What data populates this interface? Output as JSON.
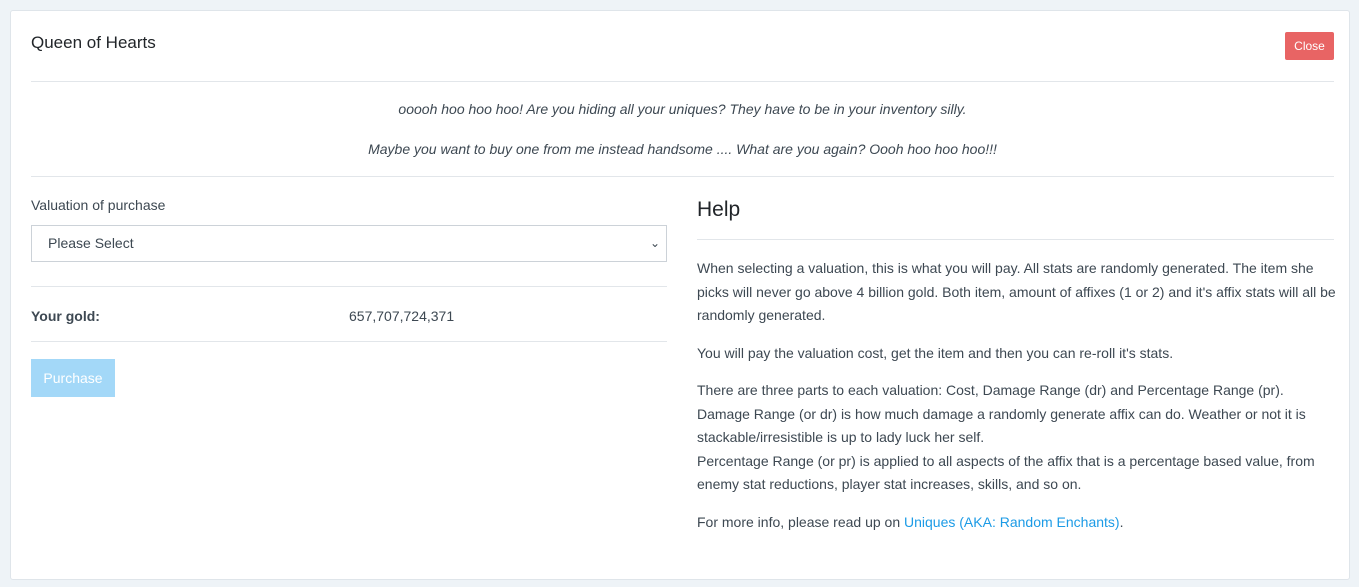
{
  "modal": {
    "title": "Queen of Hearts",
    "close_label": "Close"
  },
  "quotes": [
    "ooooh hoo hoo hoo! Are you hiding all your uniques? They have to be in your inventory silly.",
    "Maybe you want to buy one from me instead handsome .... What are you again? Oooh hoo hoo hoo!!!"
  ],
  "form": {
    "valuation_label": "Valuation of purchase",
    "valuation_selected": "Please Select",
    "gold_label": "Your gold:",
    "gold_value": "657,707,724,371",
    "purchase_label": "Purchase"
  },
  "help": {
    "title": "Help",
    "p1": "When selecting a valuation, this is what you will pay. All stats are randomly generated. The item she picks will never go above 4 billion gold. Both item, amount of affixes (1 or 2) and it's affix stats will all be randomly generated.",
    "p2": "You will pay the valuation cost, get the item and then you can re-roll it's stats.",
    "p3a": "There are three parts to each valuation: Cost, Damage Range (dr) and Percentage Range (pr).",
    "p3b": "Damage Range (or dr) is how much damage a randomly generate affix can do. Weather or not it is stackable/irresistible is up to lady luck her self.",
    "p3c": "Percentage Range (or pr) is applied to all aspects of the affix that is a percentage based value, from enemy stat reductions, player stat increases, skills, and so on.",
    "p4_prefix": "For more info, please read up on ",
    "p4_link": "Uniques (AKA: Random Enchants)",
    "p4_suffix": "."
  }
}
